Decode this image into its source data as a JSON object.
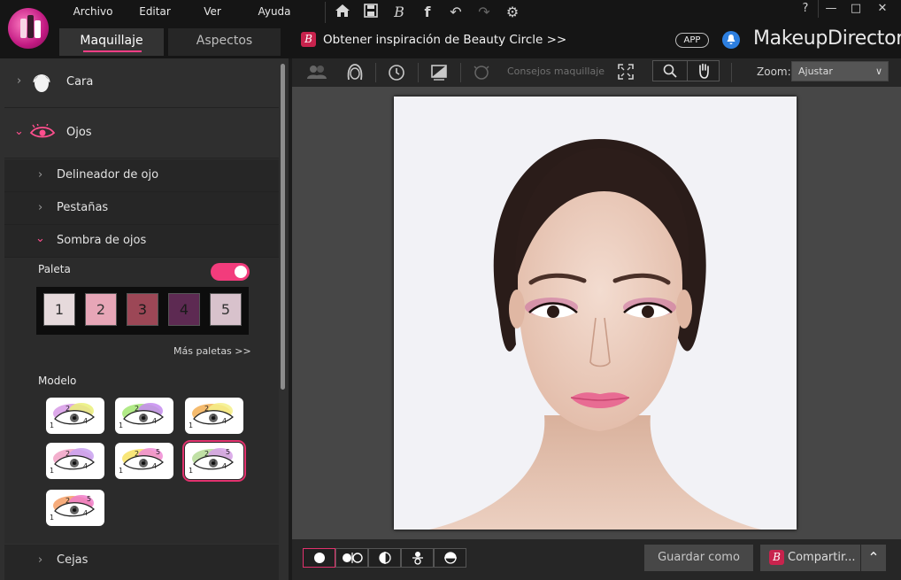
{
  "app": {
    "brand": "MakeupDirector"
  },
  "menu": [
    "Archivo",
    "Editar",
    "Ver",
    "Ayuda"
  ],
  "window_controls": [
    "?",
    "—",
    "□",
    "✕"
  ],
  "tabs": {
    "active": "Maquillaje",
    "inactive": "Aspectos"
  },
  "banner": {
    "text": "Obtener inspiración de Beauty Circle >>",
    "app_label": "APP",
    "icon_letter": "B"
  },
  "left_panel": {
    "categories": {
      "face": "Cara",
      "eyes": "Ojos",
      "brows": "Cejas"
    },
    "eye_items": [
      "Delineador de ojo",
      "Pestañas",
      "Sombra de ojos"
    ],
    "palette_label": "Paleta",
    "palette_enabled": true,
    "swatches": [
      {
        "label": "1",
        "color": "#e6dadc"
      },
      {
        "label": "2",
        "color": "#e7a6b7"
      },
      {
        "label": "3",
        "color": "#9c4756"
      },
      {
        "label": "4",
        "color": "#5d2a52"
      },
      {
        "label": "5",
        "color": "#d8c2cc"
      }
    ],
    "more_palettes": "Más paletas >>",
    "model_label": "Modelo",
    "models": [
      {
        "nums": [
          "1",
          "2",
          "3",
          "4"
        ],
        "selected": false
      },
      {
        "nums": [
          "1",
          "2",
          "3",
          "4"
        ],
        "selected": false
      },
      {
        "nums": [
          "1",
          "2",
          "3",
          "4"
        ],
        "selected": false
      },
      {
        "nums": [
          "1",
          "2",
          "3",
          "4"
        ],
        "selected": false
      },
      {
        "nums": [
          "1",
          "2",
          "3",
          "4",
          "5"
        ],
        "selected": false
      },
      {
        "nums": [
          "1",
          "2",
          "3",
          "4",
          "5"
        ],
        "selected": true
      },
      {
        "nums": [
          "1",
          "2",
          "3",
          "4",
          "5"
        ],
        "selected": false
      }
    ]
  },
  "toolbar": {
    "tips": "Consejos maquillaje",
    "zoom_label": "Zoom:",
    "zoom_value": "Ajustar"
  },
  "bottom": {
    "save": "Guardar como",
    "share": "Compartir..."
  },
  "colors": {
    "accent": "#ff3f86",
    "bg": "#2f2f2f",
    "canvas": "#474747"
  }
}
